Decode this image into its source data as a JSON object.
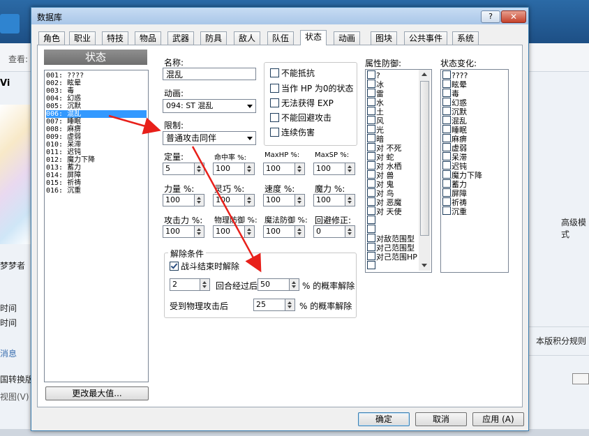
{
  "background_app": {
    "search_label": "查看:",
    "vi_label": "Vi",
    "dreamer_label": "梦梦者",
    "time_label_1": "时间",
    "time_label_2": "时间",
    "message_label": "消息",
    "convert_label": "国转换版",
    "view_menu": "视图(V)",
    "right_col_1": "高级模式",
    "right_col_2": "本版积分规则"
  },
  "dialog": {
    "title": "数据库",
    "help_label": "?",
    "close_label": "✕",
    "tabs": [
      "角色",
      "职业",
      "特技",
      "物品",
      "武器",
      "防具",
      "敌人",
      "队伍",
      "状态",
      "动画",
      "图块",
      "公共事件",
      "系统"
    ],
    "active_tab": "状态",
    "list_header": "状态",
    "states": [
      "001: ????",
      "002: 眩晕",
      "003: 毒",
      "004: 幻惑",
      "005: 沉默",
      "006: 混乱",
      "007: 睡眠",
      "008: 麻痹",
      "009: 虚弱",
      "010: 呆滞",
      "011: 迟钝",
      "012: 魔力下降",
      "013: 蓄力",
      "014: 屏障",
      "015: 祈祷",
      "016: 沉重"
    ],
    "selected_state_index": 5,
    "max_button": "更改最大值...",
    "name_label": "名称:",
    "name_value": "混乱",
    "animation_label": "动画:",
    "animation_value": "094: ST 混乱",
    "restriction_label": "限制:",
    "restriction_value": "普通攻击同伴",
    "flags": [
      {
        "label": "不能抵抗",
        "checked": false
      },
      {
        "label": "当作 HP 为0的状态",
        "checked": false
      },
      {
        "label": "无法获得 EXP",
        "checked": false
      },
      {
        "label": "不能回避攻击",
        "checked": false
      },
      {
        "label": "连续伤害",
        "checked": false
      }
    ],
    "stats_row1": [
      {
        "label": "定量:",
        "value": "5"
      },
      {
        "label": "命中率 %:",
        "value": "100"
      },
      {
        "label": "MaxHP %:",
        "value": "100"
      },
      {
        "label": "MaxSP %:",
        "value": "100"
      }
    ],
    "stats_row2": [
      {
        "label": "力量 %:",
        "value": "100"
      },
      {
        "label": "灵巧 %:",
        "value": "100"
      },
      {
        "label": "速度 %:",
        "value": "100"
      },
      {
        "label": "魔力 %:",
        "value": "100"
      }
    ],
    "stats_row3": [
      {
        "label": "攻击力 %:",
        "value": "100"
      },
      {
        "label": "物理防御 %:",
        "value": "100"
      },
      {
        "label": "魔法防御 %:",
        "value": "100"
      },
      {
        "label": "回避修正:",
        "value": "0"
      }
    ],
    "release": {
      "group_label": "解除条件",
      "battle_end_label": "战斗结束时解除",
      "battle_end_checked": true,
      "turns_value": "2",
      "turns_label": "回合经过后",
      "turns_rate": "50",
      "turns_rate_label": "% 的概率解除",
      "phys_label": "受到物理攻击后",
      "phys_rate": "25",
      "phys_rate_label": "% 的概率解除"
    },
    "element_label": "属性防御:",
    "elements": [
      "?",
      "冰",
      "雷",
      "水",
      "土",
      "风",
      "光",
      "暗",
      "对 不死",
      "对 蛇",
      "对 水栖",
      "对 兽",
      "对 鬼",
      "对 鸟",
      "对 恶魔",
      "对 天使",
      "",
      "",
      "对敌范围型",
      "对己范围型",
      "对己范围HP",
      ""
    ],
    "change_label": "状态变化:",
    "changes": [
      "????",
      "眩晕",
      "毒",
      "幻惑",
      "沉默",
      "混乱",
      "睡眠",
      "麻痹",
      "虚弱",
      "呆滞",
      "迟钝",
      "魔力下降",
      "蓄力",
      "屏障",
      "祈祷",
      "沉重"
    ],
    "ok_label": "确定",
    "cancel_label": "取消",
    "apply_label": "应用 (A)"
  }
}
